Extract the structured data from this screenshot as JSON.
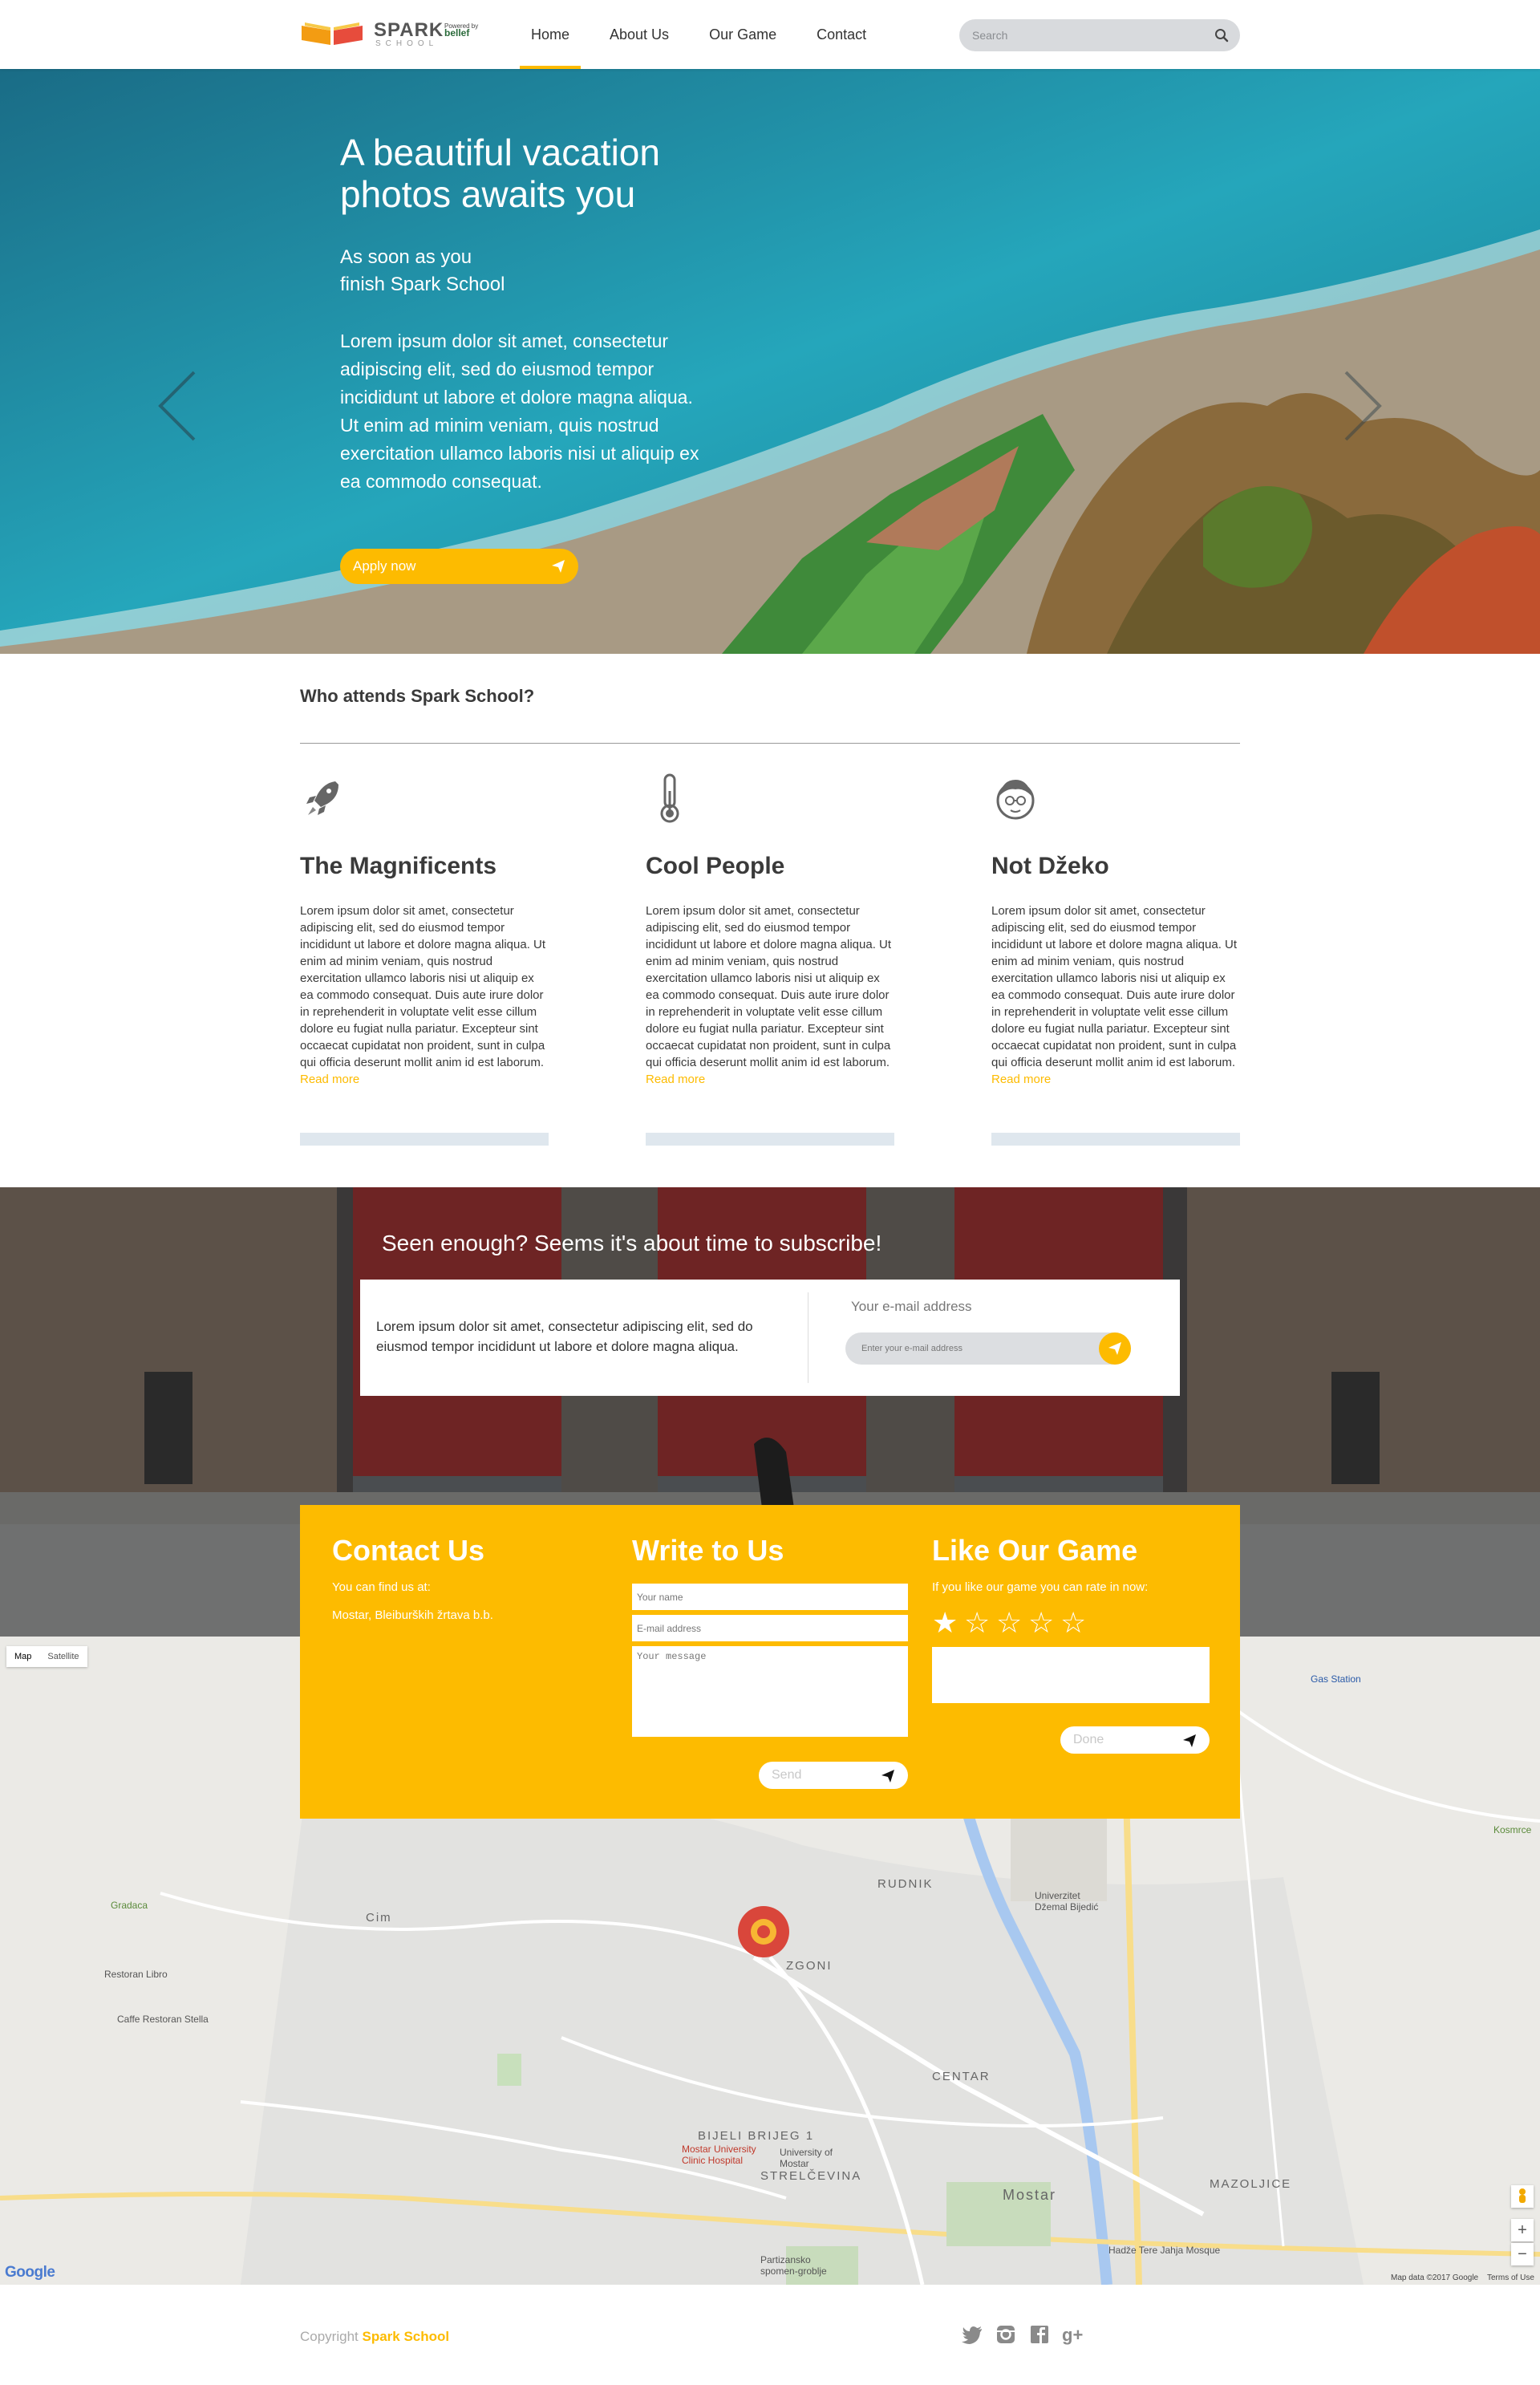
{
  "nav": {
    "logo_text": "SPARK",
    "logo_sub": "SCHOOL",
    "logo_powered": "Powered by",
    "logo_partner": "bellef",
    "links": [
      "Home",
      "About Us",
      "Our Game",
      "Contact"
    ],
    "active": "Home",
    "search_placeholder": "Search"
  },
  "hero": {
    "title": "A beautiful vacation photos awaits you",
    "subtitle_1": "As soon as you",
    "subtitle_2": "finish Spark School",
    "body": "Lorem ipsum dolor sit amet, consectetur adipiscing elit, sed do eiusmod tempor incididunt ut labore et dolore magna aliqua. Ut enim ad minim veniam, quis nostrud exercitation ullamco laboris nisi ut aliquip ex ea commodo consequat.",
    "button": "Apply now"
  },
  "who": {
    "title": "Who attends Spark School?",
    "columns": [
      {
        "icon": "rocket-icon",
        "title": "The Magnificents",
        "text": "Lorem ipsum dolor sit amet, consectetur adipiscing elit, sed do eiusmod tempor incididunt ut labore et dolore magna aliqua. Ut enim ad minim veniam, quis nostrud exercitation ullamco laboris nisi ut aliquip ex ea commodo consequat. Duis aute irure dolor in reprehenderit in voluptate velit esse cillum dolore eu fugiat nulla pariatur. Excepteur sint occaecat cupidatat non proident, sunt in culpa qui officia deserunt mollit anim id est laborum.",
        "more": "Read more"
      },
      {
        "icon": "thermometer-icon",
        "title": "Cool People",
        "text": "Lorem ipsum dolor sit amet, consectetur adipiscing elit, sed do eiusmod tempor incididunt ut labore et dolore magna aliqua. Ut enim ad minim veniam, quis nostrud exercitation ullamco laboris nisi ut aliquip ex ea commodo consequat. Duis aute irure dolor in reprehenderit in voluptate velit esse cillum dolore eu fugiat nulla pariatur. Excepteur sint occaecat cupidatat non proident, sunt in culpa qui officia deserunt mollit anim id est laborum.",
        "more": "Read more"
      },
      {
        "icon": "avatar-face-icon",
        "title": "Not Džeko",
        "text": "Lorem ipsum dolor sit amet, consectetur adipiscing elit, sed do eiusmod tempor incididunt ut labore et dolore magna aliqua. Ut enim ad minim veniam, quis nostrud exercitation ullamco laboris nisi ut aliquip ex ea commodo consequat. Duis aute irure dolor in reprehenderit in voluptate velit esse cillum dolore eu fugiat nulla pariatur. Excepteur sint occaecat cupidatat non proident, sunt in culpa qui officia deserunt mollit anim id est laborum.",
        "more": "Read more"
      }
    ]
  },
  "subscribe": {
    "title": "Seen enough? Seems it's about time to subscribe!",
    "text": "Lorem ipsum dolor sit amet, consectetur adipiscing elit, sed do eiusmod tempor incididunt ut labore et dolore magna aliqua.",
    "email_label": "Your e-mail address",
    "email_placeholder": "Enter your e-mail address"
  },
  "contact": {
    "col1": {
      "title": "Contact Us",
      "line1": "You can find us at:",
      "line2": "Mostar, Bleiburških žrtava b.b."
    },
    "col2": {
      "title": "Write to Us",
      "name_placeholder": "Your name",
      "email_placeholder": "E-mail address",
      "message_placeholder": "Your message",
      "button": "Send"
    },
    "col3": {
      "title": "Like Our Game",
      "line1": "If you like our game you can rate in now:",
      "rating": 1,
      "max_rating": 5,
      "button": "Done"
    }
  },
  "map": {
    "tabs": [
      "Map",
      "Satellite"
    ],
    "active_tab": "Map",
    "labels": {
      "gas": "Gas Station",
      "kosmrce": "Kosmrce",
      "gradaca": "Gradaca",
      "restoran": "Restoran Libro",
      "caffe": "Caffe Restoran Stella",
      "cim": "Cim",
      "rudnik": "RUDNIK",
      "zgoni": "ZGONI",
      "univerzitet": "Univerzitet Džemal Bijedić",
      "centar": "CENTAR",
      "bijeli": "BIJELI BRIJEG 1",
      "clinic": "Mostar University Clinic Hospital",
      "univ_mostar": "University of Mostar",
      "strelcevina": "STRELČEVINA",
      "mostar": "Mostar",
      "mazoljice": "MAZOLJICE",
      "hadze": "Hadže Tere Jahja Mosque",
      "partizansko": "Partizansko spomen-groblje",
      "data": "Map data ©2017 Google",
      "terms": "Terms of Use",
      "google": "Google"
    }
  },
  "footer": {
    "copy_prefix": "Copyright ",
    "copy_brand": "Spark School",
    "socials": [
      "twitter-icon",
      "instagram-icon",
      "facebook-icon",
      "google-plus-icon"
    ]
  },
  "colors": {
    "accent": "#fdbb00",
    "text": "#3a3a3a"
  }
}
